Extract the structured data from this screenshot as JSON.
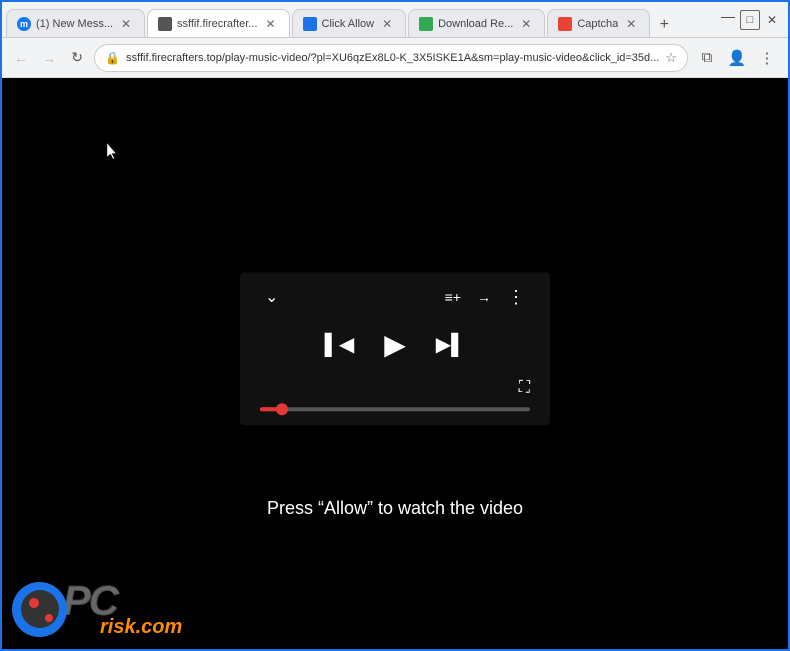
{
  "browser": {
    "tabs": [
      {
        "id": "tab1",
        "label": "(1) New Mess...",
        "favicon": "messenger",
        "active": false
      },
      {
        "id": "tab2",
        "label": "ssffif.firecrafter...",
        "favicon": "generic",
        "active": true
      },
      {
        "id": "tab3",
        "label": "Click Allow",
        "favicon": "blue",
        "active": false
      },
      {
        "id": "tab4",
        "label": "Download Re...",
        "favicon": "green",
        "active": false
      },
      {
        "id": "tab5",
        "label": "Captcha",
        "favicon": "red",
        "active": false
      }
    ],
    "address": "ssffif.firecrafters.top/play-music-video/?pl=XU6qzEx8L0-K_3X5ISKE1A&sm=play-music-video&click_id=35d...",
    "new_tab_label": "+",
    "win_min": "—",
    "win_max": "□",
    "win_close": "✕"
  },
  "player": {
    "chevron_down": "⌄",
    "queue_icon": "☰",
    "share_icon": "↗",
    "more_icon": "⋮",
    "prev_icon": "⏮",
    "play_icon": "▶",
    "next_icon": "⏭",
    "fullscreen_icon": "⛶",
    "progress_percent": 8
  },
  "page": {
    "caption": "Press “Allow” to watch the video",
    "logo_pc": "PC",
    "logo_risk": "risk.com"
  },
  "colors": {
    "accent_blue": "#1a73e8",
    "progress_red": "#e53935",
    "logo_orange": "#ff8c00"
  }
}
